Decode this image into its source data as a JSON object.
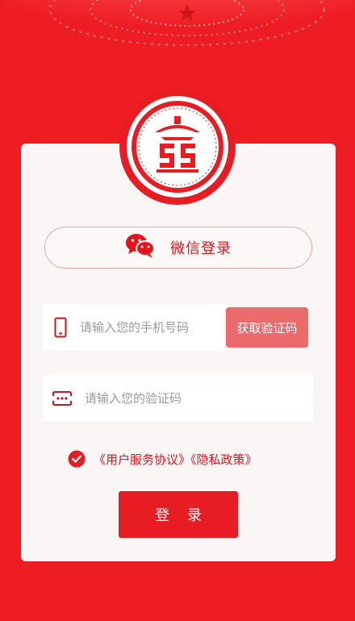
{
  "wechat_login": {
    "icon": "wechat-icon",
    "label": "微信登录"
  },
  "phone": {
    "icon": "phone-icon",
    "placeholder": "请输入您的手机号码",
    "value": ""
  },
  "get_code_label": "获取验证码",
  "code": {
    "icon": "dots-icon",
    "placeholder": "请输入您的验证码",
    "value": ""
  },
  "agreement": {
    "checked": true,
    "user_agreement": "《用户服务协议》",
    "privacy_policy": "《隐私政策》"
  },
  "login_label": "登 录",
  "colors": {
    "primary": "#e81c23",
    "background": "#ee1d23",
    "card": "#fbf6f6",
    "get_code_button": "#eb6a6c"
  }
}
